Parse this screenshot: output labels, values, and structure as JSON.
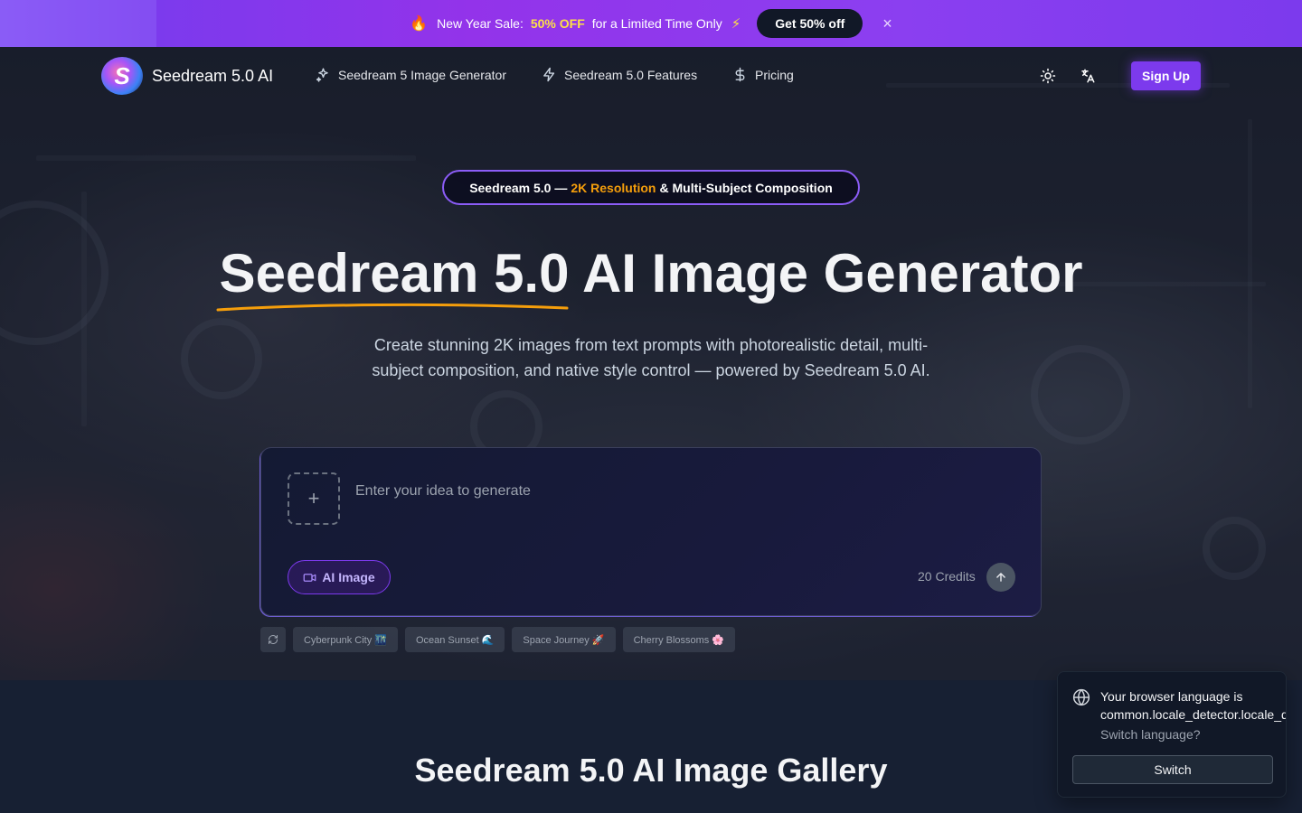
{
  "promo": {
    "fire_icon": "🔥",
    "text_before": "New Year Sale:",
    "highlight": "50% OFF",
    "text_after": "for a Limited Time Only",
    "bolt_icon": "⚡",
    "cta_label": "Get 50% off",
    "close_icon": "×"
  },
  "nav": {
    "logo_letter": "S",
    "brand": "Seedream 5.0 AI",
    "links": [
      {
        "label": "Seedream 5 Image Generator",
        "icon": "sparkles-icon"
      },
      {
        "label": "Seedream 5.0 Features",
        "icon": "bolt-icon"
      },
      {
        "label": "Pricing",
        "icon": "dollar-icon"
      }
    ],
    "signup_label": "Sign Up"
  },
  "hero": {
    "pill_before": "Seedream 5.0 —",
    "pill_highlight": "2K Resolution",
    "pill_after": "& Multi-Subject Composition",
    "title_underlined": "Seedream 5.0",
    "title_rest": "AI Image Generator",
    "subtitle": "Create stunning 2K images from text prompts with photorealistic detail, multi-subject composition, and native style control — powered by Seedream 5.0 AI."
  },
  "prompt": {
    "placeholder": "Enter your idea to generate",
    "value": "",
    "upload_icon": "+",
    "mode_label": "AI Image",
    "credits": "20 Credits"
  },
  "suggestions": [
    "Cyberpunk City 🌃",
    "Ocean Sunset 🌊",
    "Space Journey 🚀",
    "Cherry Blossoms 🌸"
  ],
  "gallery": {
    "title": "Seedream 5.0 AI Image Gallery"
  },
  "toast": {
    "message_line1": "Your browser language is",
    "message_line2": "common.locale_detector.locale_de",
    "question": "Switch language?",
    "button": "Switch"
  },
  "colors": {
    "accent": "#7c3aed",
    "highlight": "#f59e0b",
    "promo_highlight": "#fde047"
  }
}
